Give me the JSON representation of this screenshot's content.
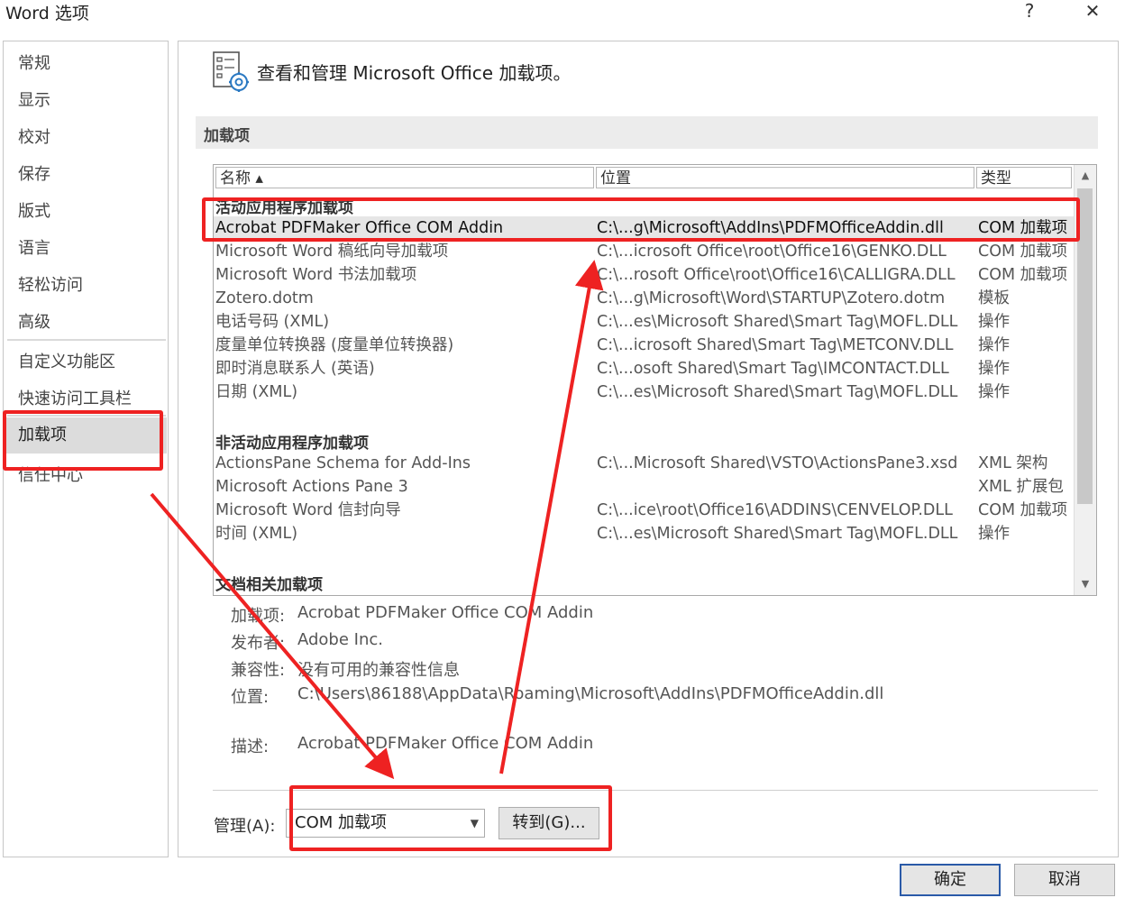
{
  "window": {
    "title": "Word 选项",
    "help": "?",
    "close": "✕"
  },
  "sidebar": {
    "items": [
      {
        "label": "常规"
      },
      {
        "label": "显示"
      },
      {
        "label": "校对"
      },
      {
        "label": "保存"
      },
      {
        "label": "版式"
      },
      {
        "label": "语言"
      },
      {
        "label": "轻松访问"
      },
      {
        "label": "高级"
      },
      {
        "label": "自定义功能区"
      },
      {
        "label": "快速访问工具栏"
      },
      {
        "label": "加载项"
      },
      {
        "label": "信任中心"
      }
    ],
    "selected": "加载项"
  },
  "main": {
    "heading": "查看和管理 Microsoft Office 加载项。",
    "heading_icon": "addins-settings-icon",
    "section_label": "加载项",
    "columns": {
      "name": "名称 ▴",
      "location": "位置",
      "type": "类型"
    },
    "groups": {
      "active": "活动应用程序加载项",
      "inactive": "非活动应用程序加载项",
      "document": "文档相关加载项"
    },
    "active_rows": [
      {
        "name": "Acrobat PDFMaker Office COM Addin",
        "location": "C:\\...g\\Microsoft\\AddIns\\PDFMOfficeAddin.dll",
        "type": "COM 加载项"
      },
      {
        "name": "Microsoft Word 稿纸向导加载项",
        "location": "C:\\...icrosoft Office\\root\\Office16\\GENKO.DLL",
        "type": "COM 加载项"
      },
      {
        "name": "Microsoft Word 书法加载项",
        "location": "C:\\...rosoft Office\\root\\Office16\\CALLIGRA.DLL",
        "type": "COM 加载项"
      },
      {
        "name": "Zotero.dotm",
        "location": "C:\\...g\\Microsoft\\Word\\STARTUP\\Zotero.dotm",
        "type": "模板"
      },
      {
        "name": "电话号码 (XML)",
        "location": "C:\\...es\\Microsoft Shared\\Smart Tag\\MOFL.DLL",
        "type": "操作"
      },
      {
        "name": "度量单位转换器 (度量单位转换器)",
        "location": "C:\\...icrosoft Shared\\Smart Tag\\METCONV.DLL",
        "type": "操作"
      },
      {
        "name": "即时消息联系人 (英语)",
        "location": "C:\\...osoft Shared\\Smart Tag\\IMCONTACT.DLL",
        "type": "操作"
      },
      {
        "name": "日期 (XML)",
        "location": "C:\\...es\\Microsoft Shared\\Smart Tag\\MOFL.DLL",
        "type": "操作"
      }
    ],
    "inactive_rows": [
      {
        "name": "ActionsPane Schema for Add-Ins",
        "location": "C:\\...Microsoft Shared\\VSTO\\ActionsPane3.xsd",
        "type": "XML 架构"
      },
      {
        "name": "Microsoft Actions Pane 3",
        "location": "",
        "type": "XML 扩展包"
      },
      {
        "name": "Microsoft Word 信封向导",
        "location": "C:\\...ice\\root\\Office16\\ADDINS\\CENVELOP.DLL",
        "type": "COM 加载项"
      },
      {
        "name": "时间 (XML)",
        "location": "C:\\...es\\Microsoft Shared\\Smart Tag\\MOFL.DLL",
        "type": "操作"
      }
    ],
    "details": {
      "addin_label": "加载项:",
      "addin_value": "Acrobat PDFMaker Office COM Addin",
      "publisher_label": "发布者:",
      "publisher_value": "Adobe Inc.",
      "compat_label": "兼容性:",
      "compat_value": "没有可用的兼容性信息",
      "location_label": "位置:",
      "location_value": "C:\\Users\\86188\\AppData\\Roaming\\Microsoft\\AddIns\\PDFMOfficeAddin.dll",
      "desc_label": "描述:",
      "desc_value": "Acrobat PDFMaker Office COM Addin"
    },
    "manage": {
      "label": "管理(A):",
      "selected": "COM 加载项",
      "goto": "转到(G)..."
    }
  },
  "footer": {
    "ok": "确定",
    "cancel": "取消"
  },
  "annotation_color": "#ee2222"
}
